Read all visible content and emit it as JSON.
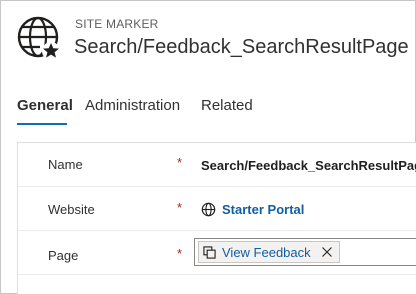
{
  "header": {
    "entity_type": "SITE MARKER",
    "record_title": "Search/Feedback_SearchResultPage",
    "icon": "globe-star-icon"
  },
  "tabs": [
    {
      "label": "General",
      "active": true
    },
    {
      "label": "Administration",
      "active": false
    },
    {
      "label": "Related",
      "active": false
    }
  ],
  "form": {
    "name": {
      "label": "Name",
      "required": "*",
      "value": "Search/Feedback_SearchResultPage"
    },
    "website": {
      "label": "Website",
      "required": "*",
      "value": "Starter Portal",
      "icon": "globe-icon"
    },
    "page": {
      "label": "Page",
      "required": "*",
      "value": "View Feedback",
      "icon": "record-icon",
      "remove_icon": "close-icon"
    }
  },
  "colors": {
    "accent": "#0f6cbd",
    "link": "#115ea3",
    "required": "#a4262c"
  }
}
